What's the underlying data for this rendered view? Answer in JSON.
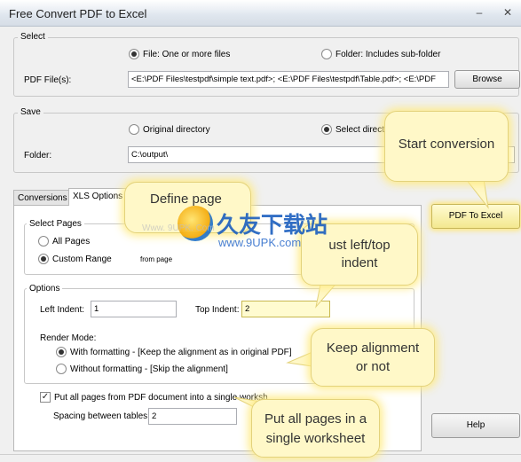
{
  "window": {
    "title": "Free Convert PDF to Excel",
    "minimize_glyph": "–",
    "close_glyph": "✕"
  },
  "select": {
    "label": "Select",
    "option_file": "File:  One or more files",
    "option_folder": "Folder: Includes sub-folder",
    "pdf_files_label": "PDF File(s):",
    "pdf_files_value": "<E:\\PDF Files\\testpdf\\simple text.pdf>; <E:\\PDF Files\\testpdf\\Table.pdf>; <E:\\PDF",
    "browse_label": "Browse"
  },
  "save": {
    "label": "Save",
    "option_original": "Original directory",
    "option_select": "Select directo",
    "folder_label": "Folder:",
    "folder_value": "C:\\output\\"
  },
  "tabs": [
    {
      "label": "Conversions"
    },
    {
      "label": "XLS Options"
    }
  ],
  "select_pages": {
    "label": "Select Pages",
    "all_pages": "All Pages",
    "custom_range": "Custom Range",
    "from_page": "from page"
  },
  "options": {
    "label": "Options",
    "left_indent_label": "Left Indent:",
    "left_indent_value": "1",
    "top_indent_label": "Top Indent:",
    "top_indent_value": "2",
    "render_mode_label": "Render Mode:",
    "with_formatting": "With formatting - [Keep the alignment as in original PDF]",
    "without_formatting": "Without formatting - [Skip the alignment]",
    "single_sheet": "Put all pages from PDF document into a single worksh",
    "spacing_label": "Spacing between tables:",
    "spacing_value": "2"
  },
  "buttons": {
    "pdf_to_excel": "PDF To Excel",
    "help": "Help"
  },
  "callouts": {
    "start_conversion": "Start conversion",
    "define_page": "Define page",
    "adjust_indent": "ust left/top\nindent",
    "keep_alignment": "Keep alignment\nor not",
    "put_all_pages": "Put all pages in a\nsingle worksheet"
  },
  "watermark": {
    "cn_text": "久友下载站",
    "url_text": "www.9UPK.com",
    "url_small": "Www. 9UPK. Com"
  }
}
